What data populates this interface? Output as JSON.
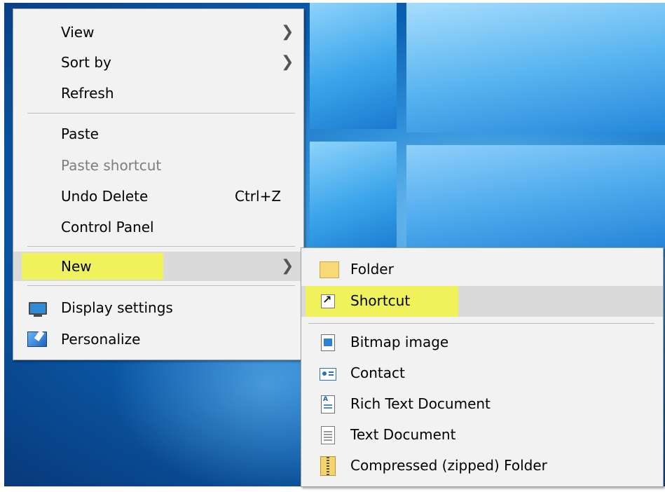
{
  "context_menu": {
    "items": [
      {
        "label": "View",
        "has_submenu": true
      },
      {
        "label": "Sort by",
        "has_submenu": true
      },
      {
        "label": "Refresh"
      },
      {
        "label": "Paste"
      },
      {
        "label": "Paste shortcut",
        "disabled": true
      },
      {
        "label": "Undo Delete",
        "accelerator": "Ctrl+Z"
      },
      {
        "label": "Control Panel"
      },
      {
        "label": "New",
        "has_submenu": true,
        "highlighted": true
      },
      {
        "label": "Display settings",
        "icon": "display-settings-icon"
      },
      {
        "label": "Personalize",
        "icon": "personalize-icon"
      }
    ]
  },
  "new_submenu": {
    "items": [
      {
        "label": "Folder",
        "icon": "folder-icon"
      },
      {
        "label": "Shortcut",
        "icon": "shortcut-icon",
        "highlighted": true
      },
      {
        "label": "Bitmap image",
        "icon": "bitmap-image-icon"
      },
      {
        "label": "Contact",
        "icon": "contact-icon"
      },
      {
        "label": "Rich Text Document",
        "icon": "rich-text-document-icon"
      },
      {
        "label": "Text Document",
        "icon": "text-document-icon"
      },
      {
        "label": "Compressed (zipped) Folder",
        "icon": "zip-folder-icon"
      }
    ]
  },
  "colors": {
    "menu_bg": "#f2f2f2",
    "hover_bg": "#dadada",
    "highlight_marker": "#f0f25c",
    "disabled_text": "#7d7d7d",
    "desktop_blue": "#0b5fb0"
  }
}
